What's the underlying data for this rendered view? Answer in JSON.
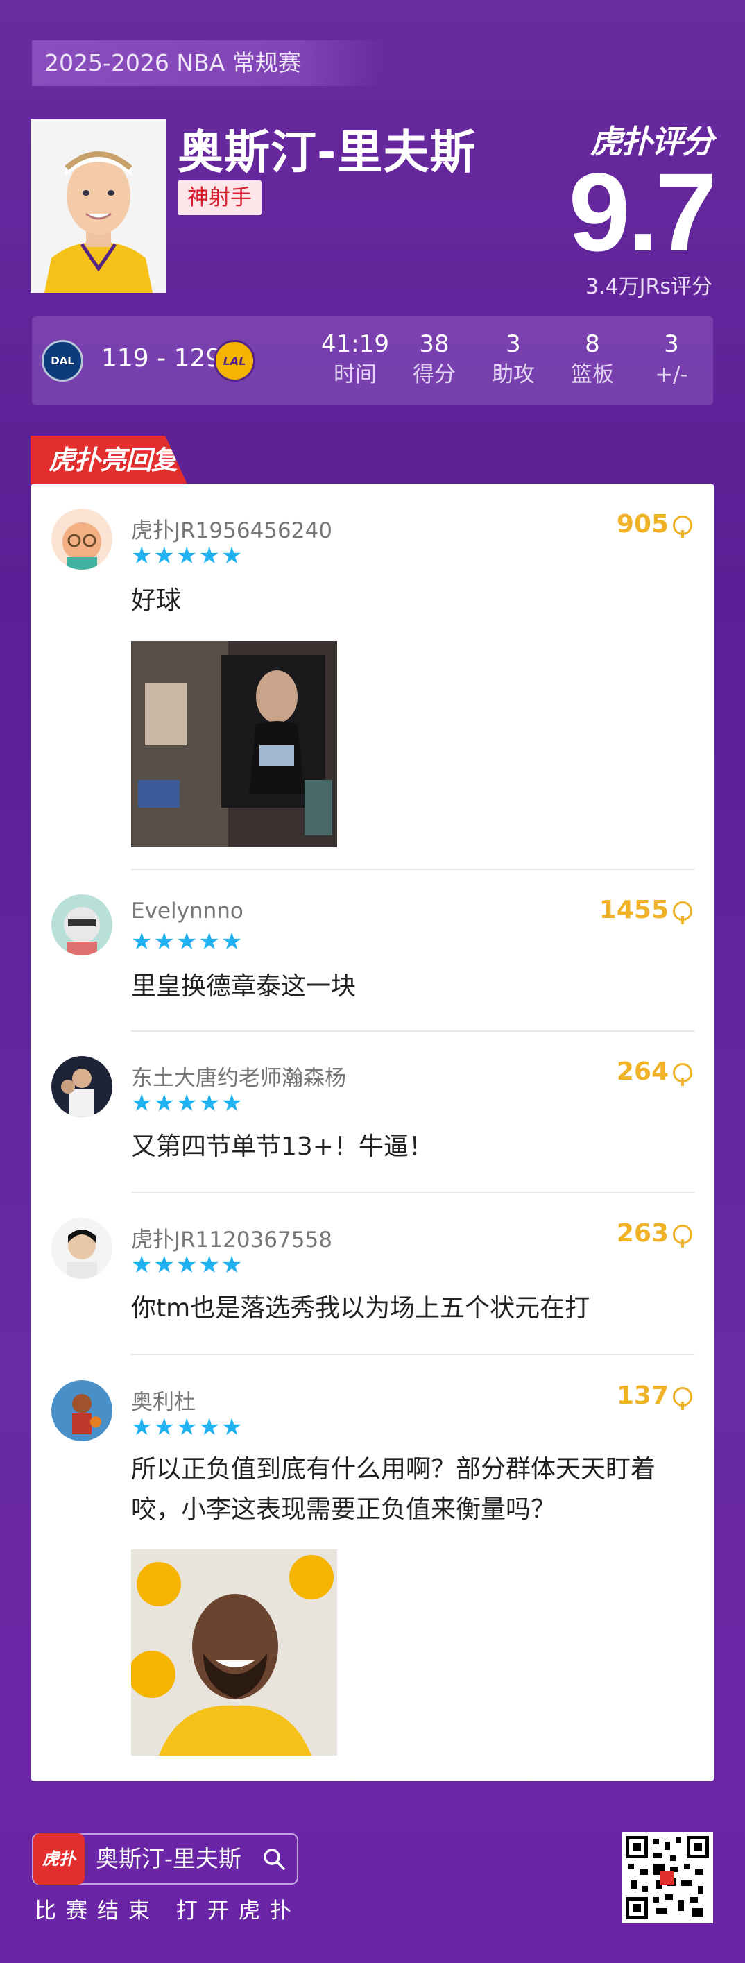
{
  "header": {
    "season": "2025-2026 NBA 常规赛",
    "player_name": "奥斯汀-里夫斯",
    "player_badge": "神射手",
    "brand": "虎扑评分",
    "score": "9.7",
    "rating_count": "3.4万JRs评分"
  },
  "game": {
    "home_team": "DAL",
    "away_team": "LAL",
    "score": "119 - 129",
    "stats": [
      {
        "value": "41:19",
        "label": "时间"
      },
      {
        "value": "38",
        "label": "得分"
      },
      {
        "value": "3",
        "label": "助攻"
      },
      {
        "value": "8",
        "label": "篮板"
      },
      {
        "value": "3",
        "label": "+/-"
      }
    ]
  },
  "hot_replies": {
    "tag": "虎扑亮回复",
    "comments": [
      {
        "user": "虎扑JR1956456240",
        "stars": "★★★★★",
        "likes": "905",
        "text": "好球"
      },
      {
        "user": "Evelynnno",
        "stars": "★★★★★",
        "likes": "1455",
        "text": "里皇换德章泰这一块"
      },
      {
        "user": "东土大唐约老师瀚森杨",
        "stars": "★★★★★",
        "likes": "264",
        "text": "又第四节单节13+！牛逼！"
      },
      {
        "user": "虎扑JR1120367558",
        "stars": "★★★★★",
        "likes": "263",
        "text": "你tm也是落选秀我以为场上五个状元在打"
      },
      {
        "user": "奥利杜",
        "stars": "★★★★★",
        "likes": "137",
        "text": "所以正负值到底有什么用啊？部分群体天天盯着咬，小李这表现需要正负值来衡量吗？"
      }
    ]
  },
  "footer": {
    "search_name": "奥斯汀-里夫斯",
    "caption": "比赛结束 打开虎扑",
    "logo_text": "虎扑"
  },
  "colors": {
    "background": "#5a1f94",
    "accent_red": "#e32e2e",
    "star_blue": "#1fb1f0",
    "likes_gold": "#f0b327"
  }
}
